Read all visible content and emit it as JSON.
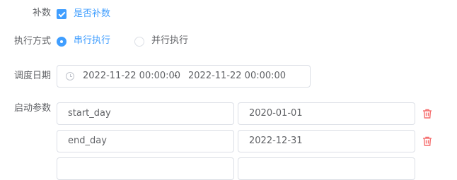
{
  "form": {
    "makeup": {
      "label": "补数",
      "checkbox_label": "是否补数",
      "checked": true
    },
    "exec_mode": {
      "label": "执行方式",
      "options": [
        {
          "label": "串行执行",
          "selected": true
        },
        {
          "label": "并行执行",
          "selected": false
        }
      ]
    },
    "schedule_date": {
      "label": "调度日期",
      "start": "2022-11-22 00:00:00",
      "separator": "-",
      "end": "2022-11-22 00:00:00"
    },
    "startup_params": {
      "label": "启动参数",
      "rows": [
        {
          "key": "start_day",
          "value": "2020-01-01"
        },
        {
          "key": "end_day",
          "value": "2022-12-31"
        }
      ]
    }
  },
  "colors": {
    "accent": "#409eff",
    "danger": "#f56c6c",
    "border": "#dcdfe6"
  }
}
